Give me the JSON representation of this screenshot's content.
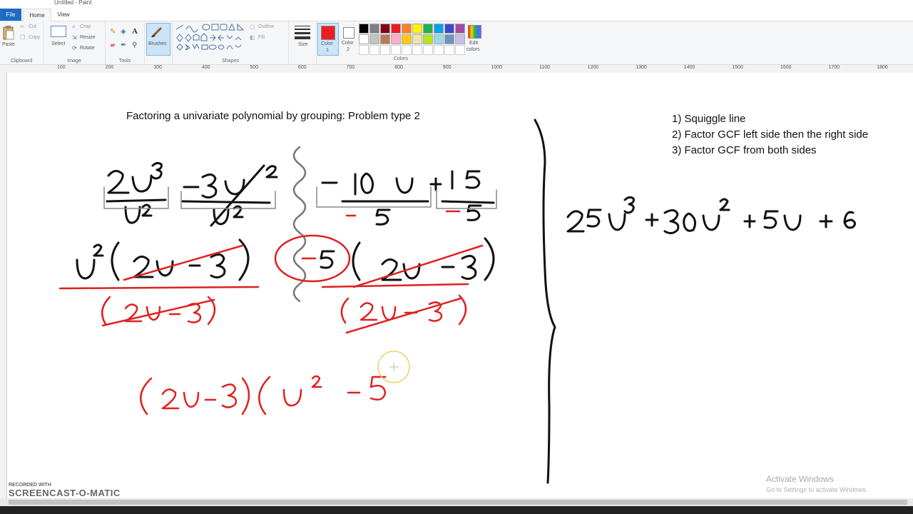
{
  "window": {
    "title": "Untitled - Paint"
  },
  "tabs": {
    "file": "File",
    "home": "Home",
    "view": "View"
  },
  "ribbon": {
    "clipboard": {
      "paste": "Paste",
      "cut": "Cut",
      "copy": "Copy",
      "label": "Clipboard"
    },
    "image": {
      "select": "Select",
      "crop": "Crop",
      "resize": "Resize",
      "rotate": "Rotate",
      "label": "Image"
    },
    "tools": {
      "label": "Tools"
    },
    "brushes": {
      "label": "Brushes"
    },
    "shapes": {
      "outline": "Outline",
      "fill": "Fill",
      "label": "Shapes"
    },
    "size": {
      "label": "Size"
    },
    "color1": {
      "label1": "Color",
      "label2": "1",
      "value": "#ed1c24"
    },
    "color2": {
      "label1": "Color",
      "label2": "2",
      "value": "#ffffff"
    },
    "colors": {
      "label": "Colors"
    },
    "edit_colors": {
      "label1": "Edit",
      "label2": "colors"
    },
    "palette_row1": [
      "#000000",
      "#7f7f7f",
      "#880015",
      "#ed1c24",
      "#ff7f27",
      "#fff200",
      "#22b14c",
      "#00a2e8",
      "#3f48cc",
      "#a349a4"
    ],
    "palette_row2": [
      "#ffffff",
      "#c3c3c3",
      "#b97a57",
      "#ffaec9",
      "#ffc90e",
      "#efe4b0",
      "#b5e61d",
      "#99d9ea",
      "#7092be",
      "#c8bfe7"
    ]
  },
  "ruler": {
    "ticks": [
      "100",
      "200",
      "300",
      "400",
      "500",
      "600",
      "700",
      "800",
      "900",
      "1000",
      "1100",
      "1200",
      "1300",
      "1400",
      "1500",
      "1600",
      "1700",
      "1800"
    ]
  },
  "canvas": {
    "title": "Factoring a univariate polynomial by grouping: Problem type 2",
    "steps": [
      "1) Squiggle line",
      "2) Factor GCF left side then the right side",
      "3) Factor GCF from both sides"
    ]
  },
  "overlay": {
    "activate_title": "Activate Windows",
    "activate_sub": "Go to Settings to activate Windows.",
    "watermark_top": "RECORDED WITH",
    "watermark_brand": "SCREENCAST-O-MATIC"
  }
}
